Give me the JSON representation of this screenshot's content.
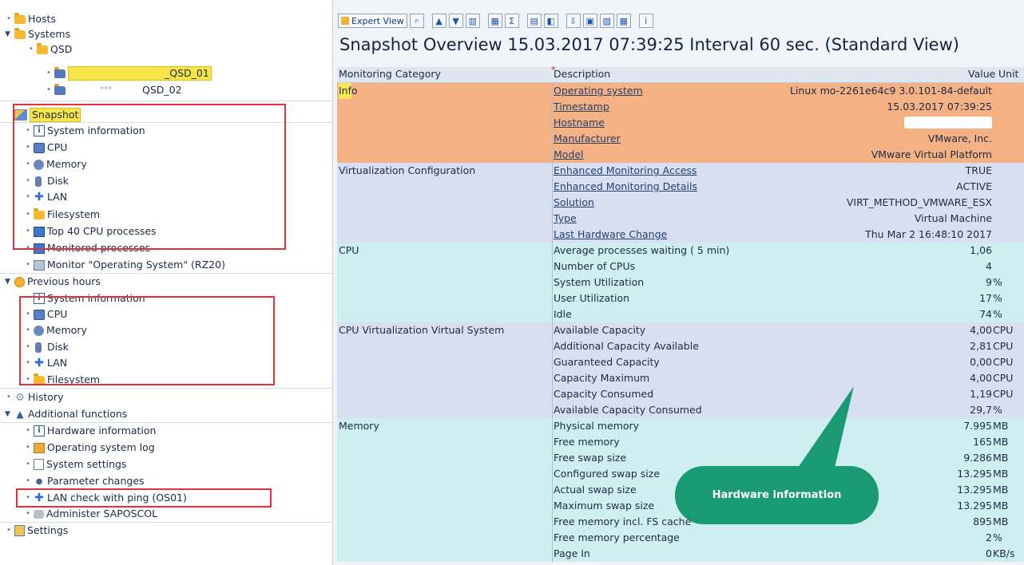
{
  "tree": {
    "hosts": "Hosts",
    "systems": "Systems",
    "qsd": "QSD",
    "system1_suffix": "_QSD_01",
    "system2_mid": "***",
    "system2_suffix": "QSD_02",
    "snapshot": "Snapshot",
    "snapshot_items": [
      "System information",
      "CPU",
      "Memory",
      "Disk",
      "LAN",
      "Filesystem",
      "Top 40 CPU processes",
      "Monitored processes"
    ],
    "monitor_os": "Monitor \"Operating System\" (RZ20)",
    "previous_hours": "Previous hours",
    "previous_items": [
      "System information",
      "CPU",
      "Memory",
      "Disk",
      "LAN",
      "Filesystem"
    ],
    "history": "History",
    "additional": "Additional functions",
    "additional_items": [
      "Hardware information",
      "Operating system log",
      "System settings",
      "Parameter changes",
      "LAN check with ping (OS01)",
      "Administer SAPOSCOL"
    ],
    "settings": "Settings"
  },
  "toolbar": {
    "expert_view": "Expert View"
  },
  "title": "Snapshot Overview 15.03.2017 07:39:25 Interval 60 sec. (Standard View)",
  "table": {
    "headers": {
      "category": "Monitoring Category",
      "description": "Description",
      "value": "Value",
      "unit": "Unit"
    },
    "info": {
      "category": "Info",
      "rows": [
        {
          "desc": "Operating system",
          "value": "Linux mo-2261e64c9 3.0.101-84-default",
          "unit": ""
        },
        {
          "desc": "Timestamp",
          "value": "15.03.2017 07:39:25",
          "unit": ""
        },
        {
          "desc": "Hostname",
          "value": "",
          "unit": ""
        },
        {
          "desc": "Manufacturer",
          "value": "VMware, Inc.",
          "unit": ""
        },
        {
          "desc": "Model",
          "value": "VMware Virtual Platform",
          "unit": ""
        }
      ]
    },
    "virt": {
      "category": "Virtualization Configuration",
      "rows": [
        {
          "desc": "Enhanced Monitoring Access",
          "value": "TRUE",
          "unit": ""
        },
        {
          "desc": "Enhanced Monitoring Details",
          "value": "ACTIVE",
          "unit": ""
        },
        {
          "desc": "Solution",
          "value": "VIRT_METHOD_VMWARE_ESX",
          "unit": ""
        },
        {
          "desc": "Type",
          "value": "Virtual Machine",
          "unit": ""
        },
        {
          "desc": "Last Hardware Change",
          "value": "Thu Mar  2 16:48:10 2017",
          "unit": ""
        }
      ]
    },
    "cpu": {
      "category": "CPU",
      "rows": [
        {
          "desc": "Average processes waiting (  5 min)",
          "value": "1,06",
          "unit": ""
        },
        {
          "desc": "Number of CPUs",
          "value": "4",
          "unit": ""
        },
        {
          "desc": "System Utilization",
          "value": "9",
          "unit": "%"
        },
        {
          "desc": "User Utilization",
          "value": "17",
          "unit": "%"
        },
        {
          "desc": "Idle",
          "value": "74",
          "unit": "%"
        }
      ]
    },
    "cpuvirt": {
      "category": "CPU Virtualization Virtual System",
      "rows": [
        {
          "desc": "Available Capacity",
          "value": "4,00",
          "unit": "CPU"
        },
        {
          "desc": "Additional Capacity Available",
          "value": "2,81",
          "unit": "CPU"
        },
        {
          "desc": "Guaranteed Capacity",
          "value": "0,00",
          "unit": "CPU"
        },
        {
          "desc": "Capacity Maximum",
          "value": "4,00",
          "unit": "CPU"
        },
        {
          "desc": "Capacity Consumed",
          "value": "1,19",
          "unit": "CPU"
        },
        {
          "desc": "Available Capacity Consumed",
          "value": "29,7",
          "unit": "%"
        }
      ]
    },
    "memory": {
      "category": "Memory",
      "rows": [
        {
          "desc": "Physical memory",
          "value": "7.995",
          "unit": "MB"
        },
        {
          "desc": "Free memory",
          "value": "165",
          "unit": "MB"
        },
        {
          "desc": "Free swap size",
          "value": "9.286",
          "unit": "MB"
        },
        {
          "desc": "Configured swap size",
          "value": "13.295",
          "unit": "MB"
        },
        {
          "desc": "Actual swap size",
          "value": "13.295",
          "unit": "MB"
        },
        {
          "desc": "Maximum swap size",
          "value": "13.295",
          "unit": "MB"
        },
        {
          "desc": "Free memory incl. FS cache",
          "value": "895",
          "unit": "MB"
        },
        {
          "desc": "Free memory percentage",
          "value": "2",
          "unit": "%"
        },
        {
          "desc": "Page In",
          "value": "0",
          "unit": "KB/s"
        }
      ]
    }
  },
  "callout": "Hardware information",
  "colors": {
    "info_bg": "#f4b183",
    "info_cat_bg": "#f7e85a",
    "virt_bg": "#d7dff0",
    "cpu_bg": "#cfeef0",
    "cpuvirt_bg": "#d7dff0",
    "memory_bg": "#cfeef0",
    "callout": "#199a73",
    "highlight_box": "#e0303a"
  }
}
